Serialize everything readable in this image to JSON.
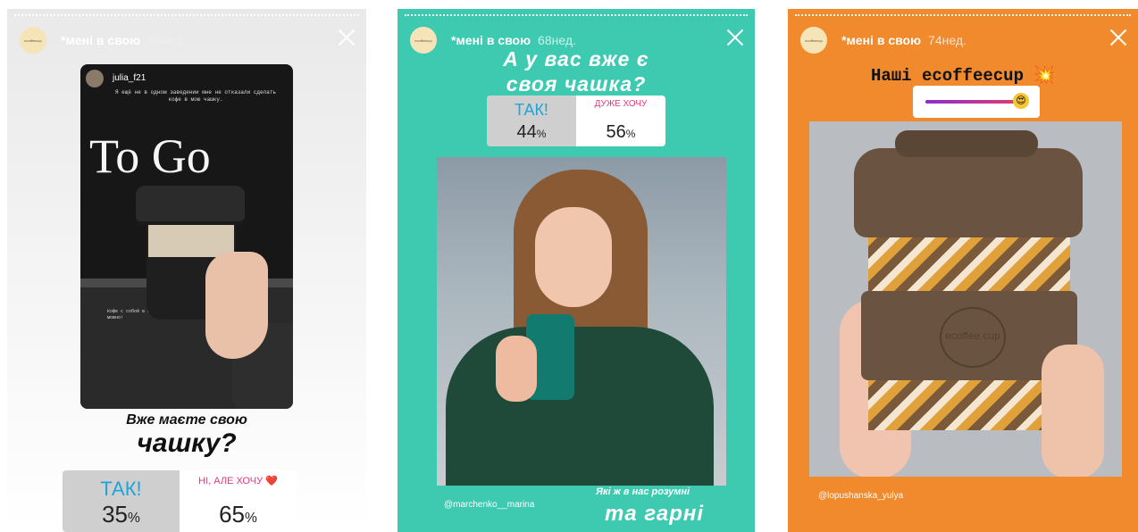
{
  "stories": [
    {
      "username": "*мені в свою",
      "time": "69нед.",
      "avatar_text": "ecoffeecup",
      "inner": {
        "username": "julia_f21",
        "text": "Я ещё не в одном заведении мне не отказали сделать кофе в мою чашку.",
        "sign": "To Go",
        "note": "Кофе с собой в свою чашечку. Да, так можно!"
      },
      "question_line1": "Вже маєте свою",
      "question_line2": "чашку?",
      "poll": {
        "option_a": "ТАК!",
        "option_b": "НІ, АЛЕ ХОЧУ ❤️",
        "pct_a": "35",
        "pct_b": "65",
        "pct_sign": "%"
      }
    },
    {
      "username": "*мені в свою",
      "time": "68нед.",
      "avatar_text": "ecoffeecup",
      "question_line1": "А у вас вже є",
      "question_line2": "своя чашка?",
      "poll": {
        "option_a": "ТАК!",
        "option_b": "ДУЖЕ ХОЧУ",
        "pct_a": "44",
        "pct_b": "56",
        "pct_sign": "%"
      },
      "credit": "@marchenko__marina",
      "caption_line1": "Які ж в нас розумні",
      "caption_line2": "та гарні"
    },
    {
      "username": "*мені в свою",
      "time": "74нед.",
      "avatar_text": "ecoffeecup",
      "title": "Наші ecoffeecup",
      "title_emoji": "💥",
      "slider_emoji": "😍",
      "slider_value": 0.88,
      "cup_logo": "ecoffee cup",
      "credit": "@lopushanska_yulya"
    }
  ],
  "colors": {
    "story2_bg": "#3ec9b1",
    "story3_bg": "#f08a2c",
    "poll_a": "#1ea4d8",
    "poll_b": "#e9347b"
  }
}
